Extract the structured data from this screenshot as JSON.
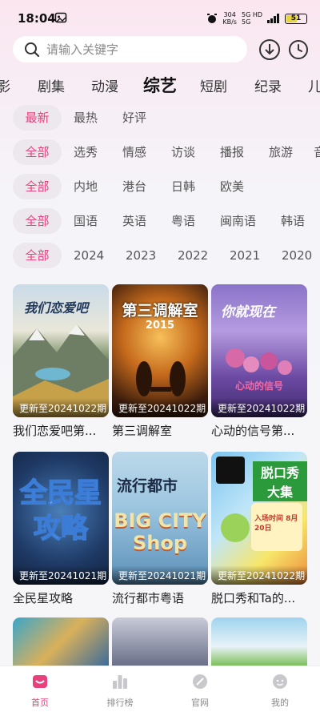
{
  "status": {
    "time": "18:04",
    "speed_top": "304",
    "speed_bottom": "KB/s",
    "net_top": "5G HD",
    "net_bottom": "5G",
    "battery": "51"
  },
  "search": {
    "placeholder": "请输入关键字"
  },
  "categories": [
    "影",
    "剧集",
    "动漫",
    "综艺",
    "短剧",
    "纪录",
    "儿"
  ],
  "active_category": "综艺",
  "filters": {
    "sort": [
      "最新",
      "最热",
      "好评"
    ],
    "type": [
      "全部",
      "选秀",
      "情感",
      "访谈",
      "播报",
      "旅游",
      "音"
    ],
    "region": [
      "全部",
      "内地",
      "港台",
      "日韩",
      "欧美"
    ],
    "language": [
      "全部",
      "国语",
      "英语",
      "粤语",
      "闽南语",
      "韩语"
    ],
    "year": [
      "全部",
      "2024",
      "2023",
      "2022",
      "2021",
      "2020"
    ]
  },
  "cards": [
    {
      "title": "我们恋爱吧第...",
      "update": "更新至20241022期",
      "poster_text": "我们恋爱吧"
    },
    {
      "title": "第三调解室",
      "update": "更新至20241022期",
      "poster_text": "第三调解室",
      "poster_sub": "2015"
    },
    {
      "title": "心动的信号第...",
      "update": "更新至20241022期",
      "poster_text": "你就现在",
      "poster_sub": "心动的信号"
    },
    {
      "title": "全民星攻略",
      "update": "更新至20241021期",
      "poster_text": "全民星攻略"
    },
    {
      "title": "流行都市粤语",
      "update": "更新至20241021期",
      "poster_text": "流行都市",
      "poster_sub": "BIG CITY Shop"
    },
    {
      "title": "脱口秀和Ta的...",
      "update": "更新至20241022期",
      "poster_text": "脱口秀大集",
      "poster_sub": "入场时间 8月20日"
    },
    {
      "title": "",
      "update": ""
    },
    {
      "title": "",
      "update": ""
    },
    {
      "title": "",
      "update": ""
    }
  ],
  "nav": [
    "首页",
    "排行榜",
    "官网",
    "我的"
  ],
  "colors": {
    "accent": "#e83f7d",
    "chip_bg": "#ece8ee"
  }
}
